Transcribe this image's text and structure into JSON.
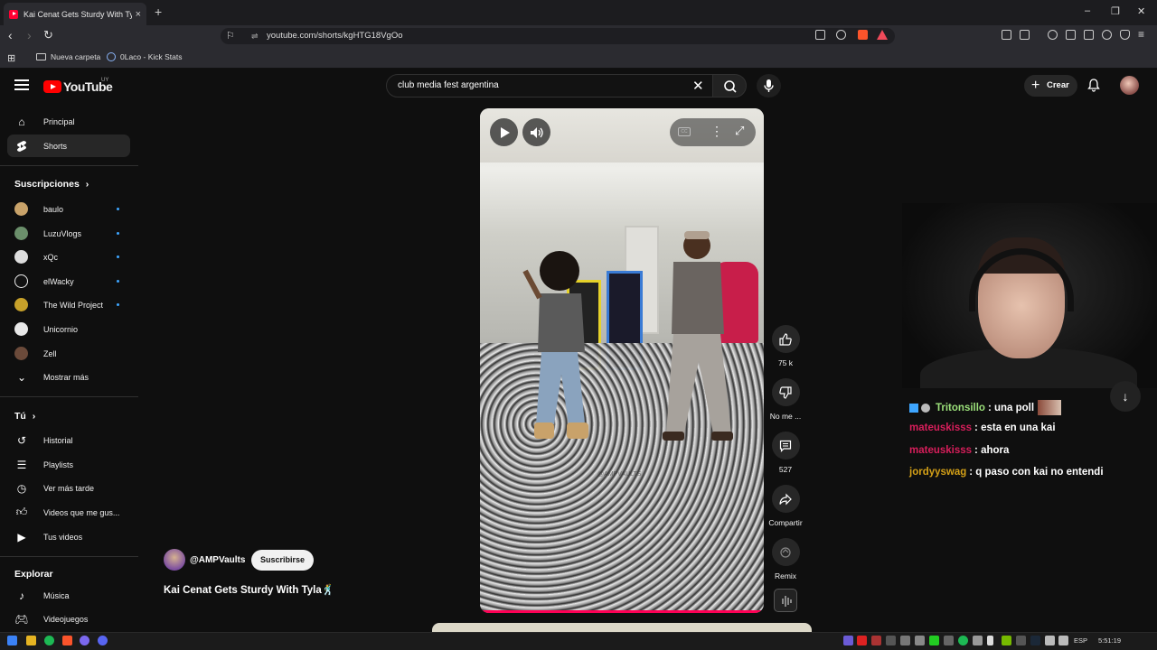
{
  "browser": {
    "tab_title": "Kai Cenat Gets Sturdy With Tyla",
    "tab_close": "×",
    "new_tab": "+",
    "url": "youtube.com/shorts/kgHTG18VgOo",
    "bookmarks": [
      {
        "label": "Nueva carpeta",
        "icon": "folder-icon"
      },
      {
        "label": "0Laco - Kick Stats",
        "icon": "kick-stats-icon"
      }
    ],
    "window_controls": {
      "minimize": "–",
      "restore": "❐",
      "close": "✕"
    }
  },
  "youtube": {
    "logo_text": "YouTube",
    "country_code": "UY",
    "search_value": "club media fest argentina",
    "create_label": "Crear"
  },
  "sidebar": {
    "main": [
      {
        "label": "Principal",
        "icon": "home-icon"
      },
      {
        "label": "Shorts",
        "icon": "shorts-icon"
      }
    ],
    "subscriptions_title": "Suscripciones",
    "subscriptions": [
      {
        "label": "baulo",
        "color": "#c9a36a"
      },
      {
        "label": "LuzuVlogs",
        "color": "#6b8f6b"
      },
      {
        "label": "xQc",
        "color": "#dddddd"
      },
      {
        "label": "elWacky",
        "color": "#111111"
      },
      {
        "label": "The Wild Project",
        "color": "#c7a12a"
      },
      {
        "label": "Unicornio",
        "color": "#e8e8e8"
      },
      {
        "label": "Zell",
        "color": "#6b4a3a"
      }
    ],
    "show_more": "Mostrar más",
    "you_title": "Tú",
    "you_items": [
      {
        "label": "Historial",
        "icon": "history-icon"
      },
      {
        "label": "Playlists",
        "icon": "playlists-icon"
      },
      {
        "label": "Ver más tarde",
        "icon": "watch-later-icon"
      },
      {
        "label": "Videos que me gus...",
        "icon": "liked-videos-icon"
      },
      {
        "label": "Tus videos",
        "icon": "your-videos-icon"
      }
    ],
    "explore_title": "Explorar",
    "explore_items": [
      {
        "label": "Música",
        "icon": "music-icon"
      },
      {
        "label": "Videojuegos",
        "icon": "gaming-icon"
      }
    ]
  },
  "short": {
    "watermark": "@AMPVAULTS",
    "progress": 1.0,
    "actions": {
      "likes": "75 k",
      "dislike": "No me ...",
      "comments": "527",
      "share": "Compartir",
      "remix": "Remix"
    },
    "channel": "@AMPVaults",
    "subscribe": "Suscribirse",
    "title": "Kai Cenat Gets Sturdy With Tyla🕺"
  },
  "chat": [
    {
      "user": "Tritonsillo",
      "color": "#9be07a",
      "text": ": una poll"
    },
    {
      "user": "mateuskisss",
      "color": "#d81e5b",
      "text": ": esta en una kai"
    },
    {
      "user": "mateuskisss",
      "color": "#d81e5b",
      "text": ": ahora"
    },
    {
      "user": "jordyyswag",
      "color": "#d4a017",
      "text": ": q paso con kai no entendi"
    }
  ],
  "taskbar": {
    "lang": "ESP",
    "time": "5:51:19"
  }
}
